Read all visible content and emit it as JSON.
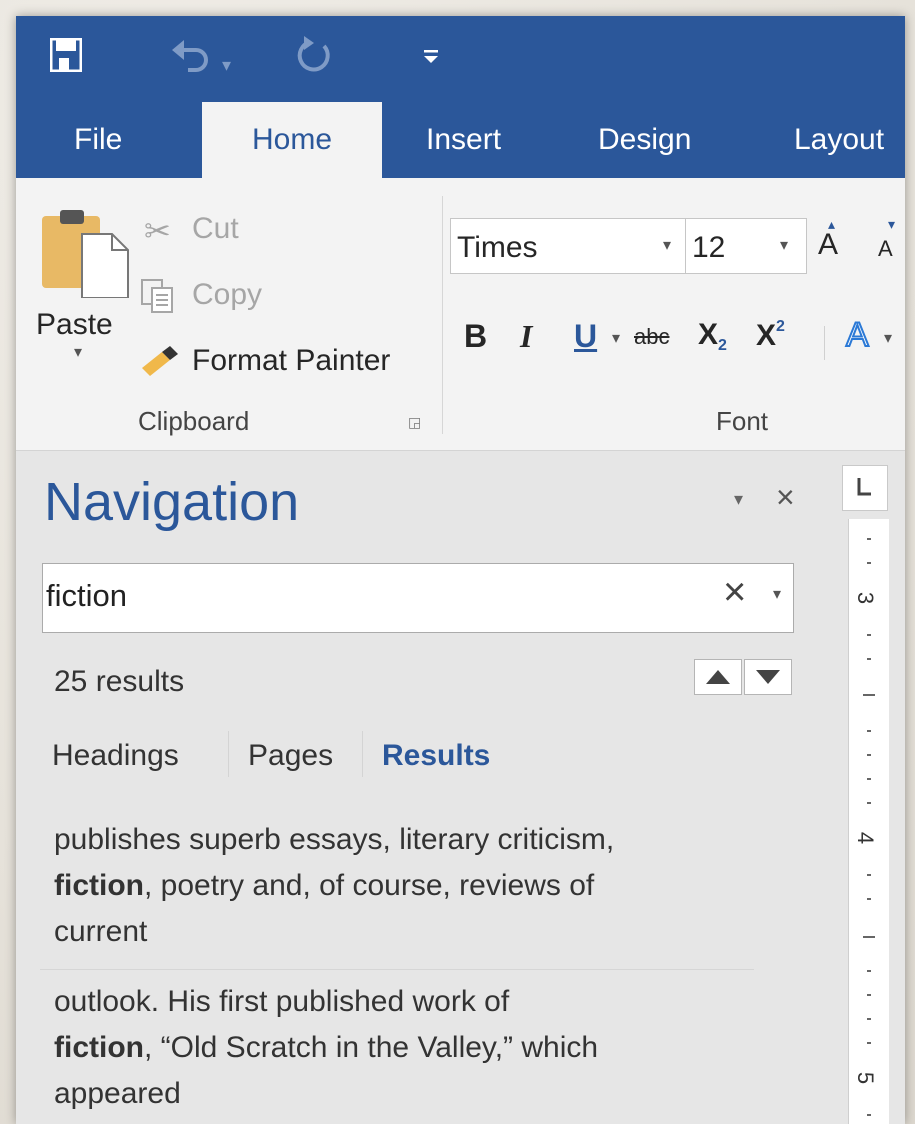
{
  "quick_access": {
    "save_icon": "save-icon",
    "undo_icon": "undo-icon",
    "redo_icon": "redo-icon",
    "customize_icon": "customize-qat-icon"
  },
  "tabs": [
    "File",
    "Home",
    "Insert",
    "Design",
    "Layout"
  ],
  "active_tab": "Home",
  "clipboard": {
    "paste": "Paste",
    "cut": "Cut",
    "copy": "Copy",
    "format_painter": "Format Painter",
    "group_label": "Clipboard"
  },
  "font": {
    "family": "Times",
    "size": "12",
    "group_label": "Font",
    "grow_label": "A",
    "shrink_label": "A",
    "bold": "B",
    "italic": "I",
    "underline": "U",
    "strikethrough": "abc",
    "subscript_base": "X",
    "subscript_mark": "2",
    "superscript_base": "X",
    "superscript_mark": "2",
    "text_effects": "A"
  },
  "navigation": {
    "title": "Navigation",
    "search_value": "fiction",
    "result_count": "25 results",
    "tabs": [
      "Headings",
      "Pages",
      "Results"
    ],
    "active_tab": "Results",
    "results": [
      {
        "line1": "publishes superb essays, literary criticism,",
        "bold": "fiction",
        "line2_rest": ", poetry and, of course, reviews of",
        "line3": "current"
      },
      {
        "line1": "outlook.  His first published work of",
        "bold": "fiction",
        "line2_rest": ", “Old Scratch in the Valley,” which",
        "line3": "appeared"
      }
    ]
  },
  "ruler": {
    "numbers": [
      "3",
      "4",
      "5"
    ],
    "corner_icon": "tab-stop-icon"
  },
  "colors": {
    "accent": "#2b579a",
    "ribbon_bg": "#f3f3f3",
    "pane_bg": "#e6e6e6"
  }
}
